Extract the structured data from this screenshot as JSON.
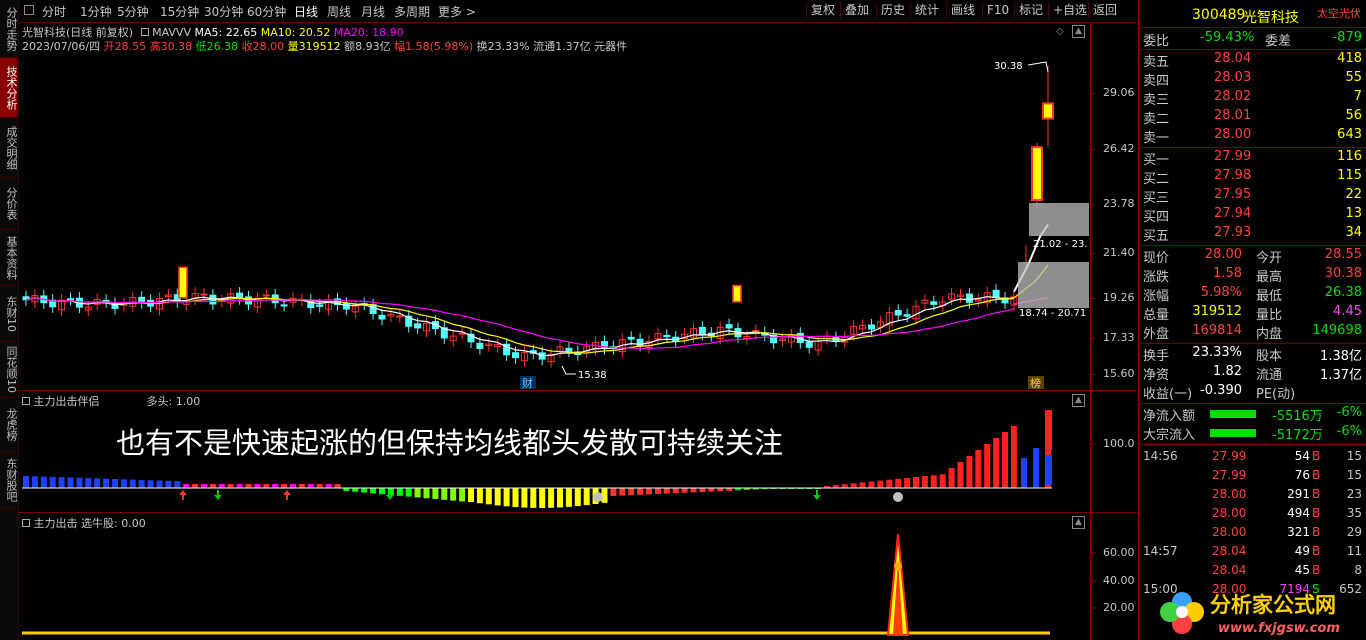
{
  "left_tabs": [
    {
      "label": "分时走势",
      "active": false
    },
    {
      "label": "技术分析",
      "active": true
    },
    {
      "label": "成交明细",
      "active": false
    },
    {
      "label": "分价表",
      "active": false
    },
    {
      "label": "基本资料",
      "active": false
    },
    {
      "label": "东财10",
      "active": false
    },
    {
      "label": "同花顺10",
      "active": false
    },
    {
      "label": "龙虎榜",
      "active": false
    },
    {
      "label": "东财股吧",
      "active": false
    }
  ],
  "toolbar": {
    "periods": [
      "分时",
      "1分钟",
      "5分钟",
      "15分钟",
      "30分钟",
      "60分钟",
      "日线",
      "周线",
      "月线",
      "多周期",
      "更多 >"
    ],
    "active_period": "日线",
    "right_buttons": [
      "复权",
      "叠加",
      "历史",
      "统计",
      "画线",
      "F10",
      "标记",
      "+自选",
      "返回"
    ]
  },
  "main_chart": {
    "title": "光智科技(日线 前复权)",
    "ma_indicator": "MAVVV",
    "ma5": "MA5: 22.65",
    "ma10": "MA10: 20.52",
    "ma20": "MA20: 18.90",
    "date": "2023/07/06/四",
    "open": "开28.55",
    "high": "高30.38",
    "low": "低26.38",
    "close": "收28.00",
    "volume": "量319512",
    "amount": "额8.93亿",
    "change": "幅1.58(5.98%)",
    "turnover": "换23.33%",
    "float": "流通1.37亿",
    "sector": "元器件",
    "y_labels": [
      "29.06",
      "26.42",
      "23.78",
      "21.40",
      "19.26",
      "17.33",
      "15.60"
    ],
    "high_marker": "30.38",
    "low_marker": "15.38",
    "box1_label": "21.02 - 23.",
    "box2_label": "18.74 - 20.71",
    "tag_cai": "财",
    "tag_bang": "榜"
  },
  "sub1": {
    "name": "主力出击伴侣",
    "param": "多头: 1.00",
    "y_label": "100.0"
  },
  "sub2": {
    "name": "主力出击",
    "param": "选牛股: 0.00",
    "y_labels": [
      "60.00",
      "40.00",
      "20.00"
    ]
  },
  "overlay_text": "也有不是快速起涨的但保持均线都头发散可持续关注",
  "quote": {
    "code": "300489",
    "name": "光智科技",
    "sector_tag": "太空光伏",
    "weibi_label": "委比",
    "weibi": "-59.43%",
    "weicha_label": "委差",
    "weicha": "-879",
    "sells": [
      {
        "label": "卖五",
        "price": "28.04",
        "vol": "418"
      },
      {
        "label": "卖四",
        "price": "28.03",
        "vol": "55"
      },
      {
        "label": "卖三",
        "price": "28.02",
        "vol": "7"
      },
      {
        "label": "卖二",
        "price": "28.01",
        "vol": "56"
      },
      {
        "label": "卖一",
        "price": "28.00",
        "vol": "643"
      }
    ],
    "buys": [
      {
        "label": "买一",
        "price": "27.99",
        "vol": "116"
      },
      {
        "label": "买二",
        "price": "27.98",
        "vol": "115"
      },
      {
        "label": "买三",
        "price": "27.95",
        "vol": "22"
      },
      {
        "label": "买四",
        "price": "27.94",
        "vol": "13"
      },
      {
        "label": "买五",
        "price": "27.93",
        "vol": "34"
      }
    ],
    "stats": [
      {
        "l1": "现价",
        "v1": "28.00",
        "l2": "今开",
        "v2": "28.55",
        "c1": "#ff4040",
        "c2": "#ff4040"
      },
      {
        "l1": "涨跌",
        "v1": "1.58",
        "l2": "最高",
        "v2": "30.38",
        "c1": "#ff4040",
        "c2": "#ff4040"
      },
      {
        "l1": "涨幅",
        "v1": "5.98%",
        "l2": "最低",
        "v2": "26.38",
        "c1": "#ff4040",
        "c2": "#00e000"
      },
      {
        "l1": "总量",
        "v1": "319512",
        "l2": "量比",
        "v2": "4.45",
        "c1": "#ffff00",
        "c2": "#ff40ff"
      },
      {
        "l1": "外盘",
        "v1": "169814",
        "l2": "内盘",
        "v2": "149698",
        "c1": "#ff4040",
        "c2": "#00e000"
      }
    ],
    "stats2": [
      {
        "l1": "换手",
        "v1": "23.33%",
        "l2": "股本",
        "v2": "1.38亿"
      },
      {
        "l1": "净资",
        "v1": "1.82",
        "l2": "流通",
        "v2": "1.37亿"
      },
      {
        "l1": "收益(一)",
        "v1": "-0.390",
        "l2": "PE(动)",
        "v2": ""
      }
    ],
    "flows": [
      {
        "label": "净流入额",
        "value": "-5516万",
        "pct": "-6%"
      },
      {
        "label": "大宗流入",
        "value": "-5172万",
        "pct": "-6%"
      }
    ],
    "ticks": [
      {
        "time": "14:56",
        "price": "27.99",
        "vol": "54",
        "side": "B",
        "n": "15"
      },
      {
        "time": "",
        "price": "27.99",
        "vol": "76",
        "side": "B",
        "n": "15"
      },
      {
        "time": "",
        "price": "28.00",
        "vol": "291",
        "side": "B",
        "n": "23"
      },
      {
        "time": "",
        "price": "28.00",
        "vol": "494",
        "side": "B",
        "n": "35"
      },
      {
        "time": "",
        "price": "28.00",
        "vol": "321",
        "side": "B",
        "n": "29"
      },
      {
        "time": "14:57",
        "price": "28.04",
        "vol": "49",
        "side": "B",
        "n": "11"
      },
      {
        "time": "",
        "price": "28.04",
        "vol": "45",
        "side": "B",
        "n": "8"
      },
      {
        "time": "15:00",
        "price": "28.00",
        "vol": "7194",
        "side": "S",
        "n": "652"
      }
    ]
  },
  "watermark": {
    "text": "分析家公式网",
    "url": "www.fxjgsw.com"
  },
  "colors": {
    "up": "#ff3232",
    "down": "#54fcfc",
    "ma5": "#ffffff",
    "ma10": "#ffff00",
    "ma20": "#ff00ff",
    "grid": "#7a0000"
  }
}
